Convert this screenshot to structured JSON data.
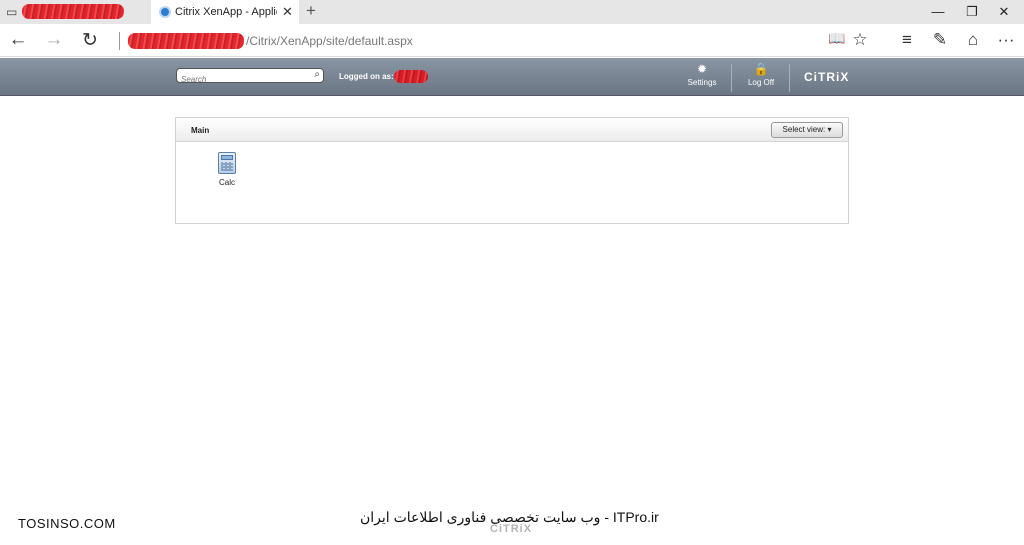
{
  "browser": {
    "active_tab_title": "Citrix XenApp - Applicat",
    "close_glyph": "✕",
    "new_tab_glyph": "+",
    "url_visible": "/Citrix/XenApp/site/default.aspx",
    "window_controls": {
      "minimize": "—",
      "restore": "❐",
      "close": "✕"
    },
    "nav": {
      "back": "←",
      "forward": "→",
      "refresh": "↻"
    },
    "tools": {
      "reading_view": "📖",
      "favorite": "☆",
      "hub": "≡",
      "note": "✎",
      "share": "⌂",
      "more": "···"
    }
  },
  "xenapp": {
    "search_placeholder": "Search",
    "search_glyph": "⌕",
    "logged_on_label": "Logged on as:",
    "settings_label": "Settings",
    "settings_glyph": "✹",
    "logoff_label": "Log Off",
    "logoff_glyph": "🔒",
    "brand": "CiTRiX",
    "panel_title": "Main",
    "select_view_label": "Select view: ▾",
    "apps": [
      {
        "name": "Calc",
        "icon": "calculator-icon"
      }
    ]
  },
  "watermarks": {
    "left": "TOSINSO.COM",
    "center": "ITPro.ir - وب سایت تخصصی فناوری اطلاعات ایران",
    "citrix": "CiTRiX"
  },
  "colors": {
    "header_bg": "#7b8794",
    "tab_bar_bg": "#e6e6e6",
    "redaction": "#e0141e"
  }
}
